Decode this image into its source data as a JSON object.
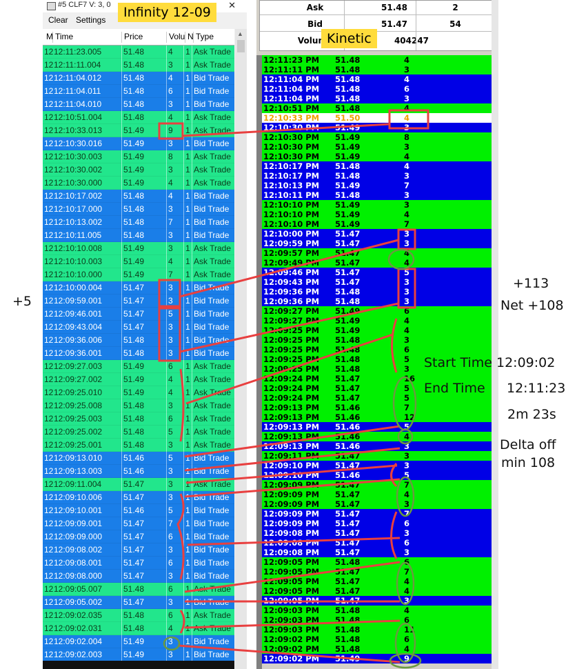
{
  "left_window": {
    "title": "#5 CLF7  V: 3, 0",
    "close_glyph": "✕",
    "menu": {
      "clear": "Clear",
      "settings": "Settings"
    },
    "columns": [
      "M",
      "Time",
      "Price",
      "Volu",
      "N",
      "Type"
    ],
    "rows": [
      {
        "m": "12",
        "time": "12:11:23.005",
        "price": "51.48",
        "vol": "4",
        "n": "1",
        "type": "Ask Trade",
        "side": "g"
      },
      {
        "m": "12",
        "time": "12:11:11.004",
        "price": "51.48",
        "vol": "3",
        "n": "1",
        "type": "Ask Trade",
        "side": "g"
      },
      {
        "m": "12",
        "time": "12:11:04.012",
        "price": "51.48",
        "vol": "4",
        "n": "1",
        "type": "Bid Trade",
        "side": "b"
      },
      {
        "m": "12",
        "time": "12:11:04.011",
        "price": "51.48",
        "vol": "6",
        "n": "1",
        "type": "Bid Trade",
        "side": "b"
      },
      {
        "m": "12",
        "time": "12:11:04.010",
        "price": "51.48",
        "vol": "3",
        "n": "1",
        "type": "Bid Trade",
        "side": "b"
      },
      {
        "m": "12",
        "time": "12:10:51.004",
        "price": "51.48",
        "vol": "4",
        "n": "1",
        "type": "Ask Trade",
        "side": "g"
      },
      {
        "m": "12",
        "time": "12:10:33.013",
        "price": "51.49",
        "vol": "9",
        "n": "1",
        "type": "Ask Trade",
        "side": "g"
      },
      {
        "m": "12",
        "time": "12:10:30.016",
        "price": "51.49",
        "vol": "3",
        "n": "1",
        "type": "Bid Trade",
        "side": "b"
      },
      {
        "m": "12",
        "time": "12:10:30.003",
        "price": "51.49",
        "vol": "8",
        "n": "1",
        "type": "Ask Trade",
        "side": "g"
      },
      {
        "m": "12",
        "time": "12:10:30.002",
        "price": "51.49",
        "vol": "3",
        "n": "1",
        "type": "Ask Trade",
        "side": "g"
      },
      {
        "m": "12",
        "time": "12:10:30.000",
        "price": "51.49",
        "vol": "4",
        "n": "1",
        "type": "Ask Trade",
        "side": "g"
      },
      {
        "m": "12",
        "time": "12:10:17.002",
        "price": "51.48",
        "vol": "4",
        "n": "1",
        "type": "Bid Trade",
        "side": "b"
      },
      {
        "m": "12",
        "time": "12:10:17.000",
        "price": "51.48",
        "vol": "3",
        "n": "1",
        "type": "Bid Trade",
        "side": "b"
      },
      {
        "m": "12",
        "time": "12:10:13.002",
        "price": "51.48",
        "vol": "7",
        "n": "1",
        "type": "Bid Trade",
        "side": "b"
      },
      {
        "m": "12",
        "time": "12:10:11.005",
        "price": "51.48",
        "vol": "3",
        "n": "1",
        "type": "Bid Trade",
        "side": "b"
      },
      {
        "m": "12",
        "time": "12:10:10.008",
        "price": "51.49",
        "vol": "3",
        "n": "1",
        "type": "Ask Trade",
        "side": "g"
      },
      {
        "m": "12",
        "time": "12:10:10.003",
        "price": "51.49",
        "vol": "4",
        "n": "1",
        "type": "Ask Trade",
        "side": "g"
      },
      {
        "m": "12",
        "time": "12:10:10.000",
        "price": "51.49",
        "vol": "7",
        "n": "1",
        "type": "Ask Trade",
        "side": "g"
      },
      {
        "m": "12",
        "time": "12:10:00.004",
        "price": "51.47",
        "vol": "3",
        "n": "1",
        "type": "Bid Trade",
        "side": "b"
      },
      {
        "m": "12",
        "time": "12:09:59.001",
        "price": "51.47",
        "vol": "3",
        "n": "1",
        "type": "Bid Trade",
        "side": "b"
      },
      {
        "m": "12",
        "time": "12:09:46.001",
        "price": "51.47",
        "vol": "5",
        "n": "1",
        "type": "Bid Trade",
        "side": "b"
      },
      {
        "m": "12",
        "time": "12:09:43.004",
        "price": "51.47",
        "vol": "3",
        "n": "1",
        "type": "Bid Trade",
        "side": "b"
      },
      {
        "m": "12",
        "time": "12:09:36.006",
        "price": "51.48",
        "vol": "3",
        "n": "1",
        "type": "Bid Trade",
        "side": "b"
      },
      {
        "m": "12",
        "time": "12:09:36.001",
        "price": "51.48",
        "vol": "3",
        "n": "1",
        "type": "Bid Trade",
        "side": "b"
      },
      {
        "m": "12",
        "time": "12:09:27.003",
        "price": "51.49",
        "vol": "6",
        "n": "1",
        "type": "Ask Trade",
        "side": "g"
      },
      {
        "m": "12",
        "time": "12:09:27.002",
        "price": "51.49",
        "vol": "4",
        "n": "1",
        "type": "Ask Trade",
        "side": "g"
      },
      {
        "m": "12",
        "time": "12:09:25.010",
        "price": "51.49",
        "vol": "4",
        "n": "1",
        "type": "Ask Trade",
        "side": "g"
      },
      {
        "m": "12",
        "time": "12:09:25.008",
        "price": "51.48",
        "vol": "3",
        "n": "1",
        "type": "Ask Trade",
        "side": "g"
      },
      {
        "m": "12",
        "time": "12:09:25.003",
        "price": "51.48",
        "vol": "6",
        "n": "1",
        "type": "Ask Trade",
        "side": "g"
      },
      {
        "m": "12",
        "time": "12:09:25.002",
        "price": "51.48",
        "vol": "5",
        "n": "1",
        "type": "Ask Trade",
        "side": "g"
      },
      {
        "m": "12",
        "time": "12:09:25.001",
        "price": "51.48",
        "vol": "3",
        "n": "1",
        "type": "Ask Trade",
        "side": "g"
      },
      {
        "m": "12",
        "time": "12:09:13.010",
        "price": "51.46",
        "vol": "5",
        "n": "1",
        "type": "Bid Trade",
        "side": "b"
      },
      {
        "m": "12",
        "time": "12:09:13.003",
        "price": "51.46",
        "vol": "3",
        "n": "1",
        "type": "Bid Trade",
        "side": "b"
      },
      {
        "m": "12",
        "time": "12:09:11.004",
        "price": "51.47",
        "vol": "3",
        "n": "1",
        "type": "Ask Trade",
        "side": "g"
      },
      {
        "m": "12",
        "time": "12:09:10.006",
        "price": "51.47",
        "vol": "3",
        "n": "1",
        "type": "Bid Trade",
        "side": "b"
      },
      {
        "m": "12",
        "time": "12:09:10.001",
        "price": "51.46",
        "vol": "5",
        "n": "1",
        "type": "Bid Trade",
        "side": "b"
      },
      {
        "m": "12",
        "time": "12:09:09.001",
        "price": "51.47",
        "vol": "7",
        "n": "1",
        "type": "Bid Trade",
        "side": "b"
      },
      {
        "m": "12",
        "time": "12:09:09.000",
        "price": "51.47",
        "vol": "6",
        "n": "1",
        "type": "Bid Trade",
        "side": "b"
      },
      {
        "m": "12",
        "time": "12:09:08.002",
        "price": "51.47",
        "vol": "3",
        "n": "1",
        "type": "Bid Trade",
        "side": "b"
      },
      {
        "m": "12",
        "time": "12:09:08.001",
        "price": "51.47",
        "vol": "6",
        "n": "1",
        "type": "Bid Trade",
        "side": "b"
      },
      {
        "m": "12",
        "time": "12:09:08.000",
        "price": "51.47",
        "vol": "3",
        "n": "1",
        "type": "Bid Trade",
        "side": "b"
      },
      {
        "m": "12",
        "time": "12:09:05.007",
        "price": "51.48",
        "vol": "6",
        "n": "1",
        "type": "Ask Trade",
        "side": "g"
      },
      {
        "m": "12",
        "time": "12:09:05.002",
        "price": "51.47",
        "vol": "3",
        "n": "1",
        "type": "Bid Trade",
        "side": "b"
      },
      {
        "m": "12",
        "time": "12:09:02.035",
        "price": "51.48",
        "vol": "6",
        "n": "1",
        "type": "Ask Trade",
        "side": "g"
      },
      {
        "m": "12",
        "time": "12:09:02.031",
        "price": "51.48",
        "vol": "4",
        "n": "1",
        "type": "Ask Trade",
        "side": "g"
      },
      {
        "m": "12",
        "time": "12:09:02.004",
        "price": "51.49",
        "vol": "3",
        "n": "1",
        "type": "Bid Trade",
        "side": "b"
      },
      {
        "m": "12",
        "time": "12:09:02.003",
        "price": "51.49",
        "vol": "3",
        "n": "1",
        "type": "Bid Trade",
        "side": "b"
      }
    ]
  },
  "right_window": {
    "header": {
      "ask_label": "Ask",
      "ask_price": "51.48",
      "ask_size": "2",
      "bid_label": "Bid",
      "bid_price": "51.47",
      "bid_size": "54",
      "volume_label": "Volume",
      "volume_value": "404247"
    },
    "rows": [
      {
        "time": "12:11:23 PM",
        "price": "51.48",
        "vol": "4",
        "side": "g"
      },
      {
        "time": "12:11:11 PM",
        "price": "51.48",
        "vol": "3",
        "side": "g"
      },
      {
        "time": "12:11:04 PM",
        "price": "51.48",
        "vol": "4",
        "side": "b"
      },
      {
        "time": "12:11:04 PM",
        "price": "51.48",
        "vol": "6",
        "side": "b"
      },
      {
        "time": "12:11:04 PM",
        "price": "51.48",
        "vol": "3",
        "side": "b"
      },
      {
        "time": "12:10:51 PM",
        "price": "51.48",
        "vol": "4",
        "side": "g"
      },
      {
        "time": "12:10:33 PM",
        "price": "51.50",
        "vol": "4",
        "side": "w"
      },
      {
        "time": "12:10:30 PM",
        "price": "51.49",
        "vol": "3",
        "side": "b"
      },
      {
        "time": "12:10:30 PM",
        "price": "51.49",
        "vol": "8",
        "side": "g"
      },
      {
        "time": "12:10:30 PM",
        "price": "51.49",
        "vol": "3",
        "side": "g"
      },
      {
        "time": "12:10:30 PM",
        "price": "51.49",
        "vol": "4",
        "side": "g"
      },
      {
        "time": "12:10:17 PM",
        "price": "51.48",
        "vol": "4",
        "side": "b"
      },
      {
        "time": "12:10:17 PM",
        "price": "51.48",
        "vol": "3",
        "side": "b"
      },
      {
        "time": "12:10:13 PM",
        "price": "51.49",
        "vol": "7",
        "side": "b"
      },
      {
        "time": "12:10:11 PM",
        "price": "51.48",
        "vol": "3",
        "side": "b"
      },
      {
        "time": "12:10:10 PM",
        "price": "51.49",
        "vol": "3",
        "side": "g"
      },
      {
        "time": "12:10:10 PM",
        "price": "51.49",
        "vol": "4",
        "side": "g"
      },
      {
        "time": "12:10:10 PM",
        "price": "51.49",
        "vol": "7",
        "side": "g"
      },
      {
        "time": "12:10:00 PM",
        "price": "51.47",
        "vol": "3",
        "side": "b"
      },
      {
        "time": "12:09:59 PM",
        "price": "51.47",
        "vol": "3",
        "side": "b"
      },
      {
        "time": "12:09:57 PM",
        "price": "51.47",
        "vol": "4",
        "side": "g"
      },
      {
        "time": "12:09:49 PM",
        "price": "51.47",
        "vol": "4",
        "side": "g"
      },
      {
        "time": "12:09:46 PM",
        "price": "51.47",
        "vol": "5",
        "side": "b"
      },
      {
        "time": "12:09:43 PM",
        "price": "51.47",
        "vol": "3",
        "side": "b"
      },
      {
        "time": "12:09:36 PM",
        "price": "51.48",
        "vol": "3",
        "side": "b"
      },
      {
        "time": "12:09:36 PM",
        "price": "51.48",
        "vol": "3",
        "side": "b"
      },
      {
        "time": "12:09:27 PM",
        "price": "51.49",
        "vol": "6",
        "side": "g"
      },
      {
        "time": "12:09:27 PM",
        "price": "51.49",
        "vol": "4",
        "side": "g"
      },
      {
        "time": "12:09:25 PM",
        "price": "51.49",
        "vol": "4",
        "side": "g"
      },
      {
        "time": "12:09:25 PM",
        "price": "51.48",
        "vol": "3",
        "side": "g"
      },
      {
        "time": "12:09:25 PM",
        "price": "51.48",
        "vol": "6",
        "side": "g"
      },
      {
        "time": "12:09:25 PM",
        "price": "51.48",
        "vol": "5",
        "side": "g"
      },
      {
        "time": "12:09:25 PM",
        "price": "51.48",
        "vol": "3",
        "side": "g"
      },
      {
        "time": "12:09:24 PM",
        "price": "51.47",
        "vol": "16",
        "side": "g"
      },
      {
        "time": "12:09:24 PM",
        "price": "51.47",
        "vol": "5",
        "side": "g"
      },
      {
        "time": "12:09:24 PM",
        "price": "51.47",
        "vol": "5",
        "side": "g"
      },
      {
        "time": "12:09:13 PM",
        "price": "51.46",
        "vol": "7",
        "side": "g"
      },
      {
        "time": "12:09:13 PM",
        "price": "51.46",
        "vol": "12",
        "side": "g"
      },
      {
        "time": "12:09:13 PM",
        "price": "51.46",
        "vol": "5",
        "side": "b"
      },
      {
        "time": "12:09:13 PM",
        "price": "51.46",
        "vol": "4",
        "side": "g"
      },
      {
        "time": "12:09:13 PM",
        "price": "51.46",
        "vol": "3",
        "side": "b"
      },
      {
        "time": "12:09:11 PM",
        "price": "51.47",
        "vol": "3",
        "side": "g"
      },
      {
        "time": "12:09:10 PM",
        "price": "51.47",
        "vol": "3",
        "side": "b"
      },
      {
        "time": "12:09:10 PM",
        "price": "51.46",
        "vol": "5",
        "side": "b"
      },
      {
        "time": "12:09:09 PM",
        "price": "51.47",
        "vol": "7",
        "side": "g"
      },
      {
        "time": "12:09:09 PM",
        "price": "51.47",
        "vol": "4",
        "side": "g"
      },
      {
        "time": "12:09:09 PM",
        "price": "51.47",
        "vol": "3",
        "side": "g"
      },
      {
        "time": "12:09:09 PM",
        "price": "51.47",
        "vol": "7",
        "side": "b"
      },
      {
        "time": "12:09:09 PM",
        "price": "51.47",
        "vol": "6",
        "side": "b"
      },
      {
        "time": "12:09:08 PM",
        "price": "51.47",
        "vol": "3",
        "side": "b"
      },
      {
        "time": "12:09:08 PM",
        "price": "51.47",
        "vol": "6",
        "side": "b"
      },
      {
        "time": "12:09:08 PM",
        "price": "51.47",
        "vol": "3",
        "side": "b"
      },
      {
        "time": "12:09:05 PM",
        "price": "51.48",
        "vol": "6",
        "side": "g"
      },
      {
        "time": "12:09:05 PM",
        "price": "51.47",
        "vol": "7",
        "side": "g"
      },
      {
        "time": "12:09:05 PM",
        "price": "51.47",
        "vol": "4",
        "side": "g"
      },
      {
        "time": "12:09:05 PM",
        "price": "51.47",
        "vol": "4",
        "side": "g"
      },
      {
        "time": "12:09:05 PM",
        "price": "51.47",
        "vol": "3",
        "side": "b"
      },
      {
        "time": "12:09:03 PM",
        "price": "51.48",
        "vol": "4",
        "side": "g"
      },
      {
        "time": "12:09:03 PM",
        "price": "51.48",
        "vol": "6",
        "side": "g"
      },
      {
        "time": "12:09:03 PM",
        "price": "51.48",
        "vol": "11",
        "side": "g"
      },
      {
        "time": "12:09:02 PM",
        "price": "51.48",
        "vol": "6",
        "side": "g"
      },
      {
        "time": "12:09:02 PM",
        "price": "51.48",
        "vol": "4",
        "side": "g"
      },
      {
        "time": "12:09:02 PM",
        "price": "51.49",
        "vol": "9",
        "side": "b"
      }
    ]
  },
  "annotations": {
    "infinity_tag": "Infinity 12-09",
    "kinetic_tag": "Kinetic",
    "left_delta": "+5",
    "right_delta": "+113",
    "net": "Net +108",
    "start_time": "Start Time 12:09:02",
    "end_time_label": "End Time",
    "end_time_value": "12:11:23",
    "duration": "2m 23s",
    "delta_off_1": "Delta off",
    "delta_off_2": "min 108"
  },
  "colors": {
    "ask_green": "#22e68c",
    "bid_blue": "#1a7ee8",
    "kinetic_green": "#00f000",
    "kinetic_blue": "#0000e6",
    "highlight_orange": "#f0a000",
    "annotation_red": "#e84040",
    "annotation_olive": "#6a9a40",
    "tag_yellow": "#ffdc3c"
  }
}
